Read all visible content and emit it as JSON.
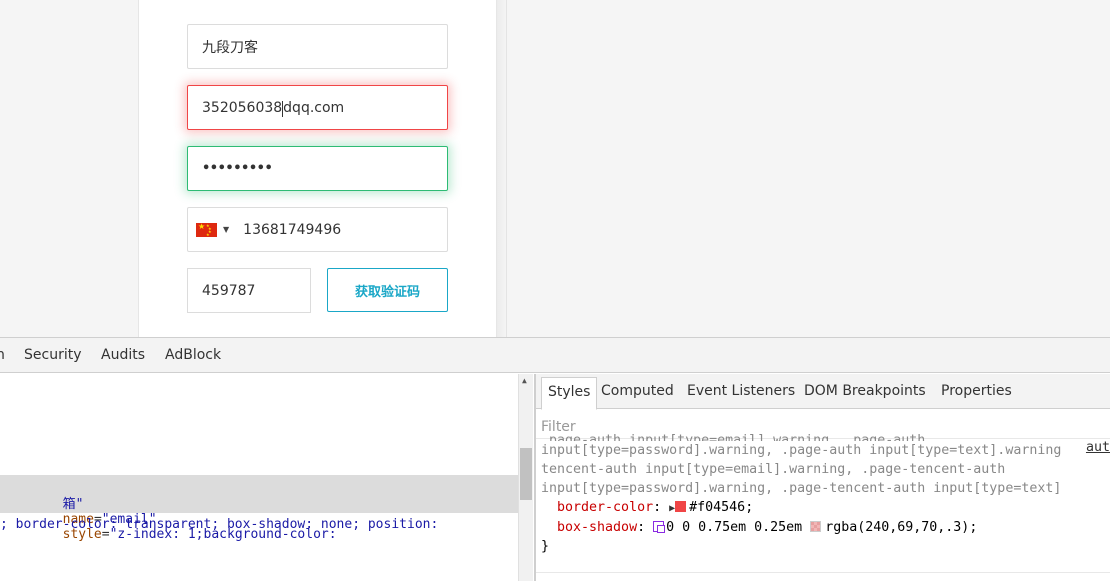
{
  "form": {
    "username_value": "九段刀客",
    "email_before_caret": "352056038",
    "email_after_caret": "dqq.com",
    "password_dots": "•••••••••",
    "phone_value": "13681749496",
    "country_flag": "china-flag-icon",
    "verify_code_value": "459787",
    "get_code_button": "获取验证码",
    "colors": {
      "warning": "#f04546",
      "ok": "#2dbb74",
      "accent": "#1aa7c7"
    }
  },
  "devtools": {
    "tabs": [
      "n",
      "Security",
      "Audits",
      "AdBlock"
    ],
    "elements": {
      "line1": {
        "prefix": "箱\"",
        "attr1": "name",
        "val1": "\"email\"",
        "attr2": "style",
        "val2": "\"z-index: 1;background-color:"
      },
      "line2": "; border-color: transparent; box-shadow: none; position:"
    },
    "styles_tabs": [
      "Styles",
      "Computed",
      "Event Listeners",
      "DOM Breakpoints",
      "Properties"
    ],
    "filter_placeholder": "Filter",
    "css": {
      "selector_line0": ".page-auth input[type=email].warning, .page-auth",
      "selector_line1": "input[type=password].warning, .page-auth input[type=text].warning",
      "selector_line2": "tencent-auth input[type=email].warning, .page-tencent-auth",
      "selector_line3": "input[type=password].warning, .page-tencent-auth input[type=text]",
      "source_link": "aut",
      "prop1_name": "border-color",
      "prop1_value": "#f04546",
      "prop2_name": "box-shadow",
      "prop2_value_a": "0 0 0.75em 0.25em",
      "prop2_value_b": "rgba(240,69,70,.3)",
      "close_brace": "}"
    }
  }
}
